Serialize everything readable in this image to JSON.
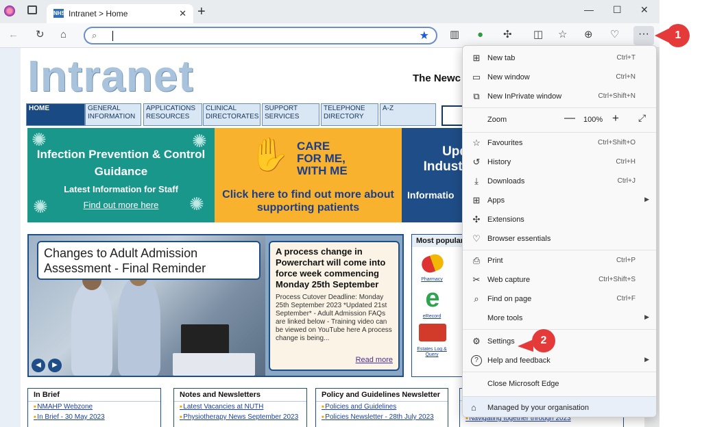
{
  "browser": {
    "tab_title": "Intranet > Home",
    "tab_icon_text": "NHS",
    "close_glyph": "✕",
    "new_tab_glyph": "+",
    "minimize_glyph": "—",
    "maximize_glyph": "☐",
    "close_window_glyph": "✕",
    "address_value": "",
    "more_glyph": "···"
  },
  "page": {
    "logo_text": "Intranet",
    "trust_name": "The Newc",
    "nav": [
      {
        "label": "HOME"
      },
      {
        "label": "GENERAL INFORMATION"
      },
      {
        "label": "APPLICATIONS RESOURCES"
      },
      {
        "label": "CLINICAL DIRECTORATES"
      },
      {
        "label": "SUPPORT SERVICES"
      },
      {
        "label": "TELEPHONE DIRECTORY"
      },
      {
        "label": "A-Z"
      }
    ],
    "banner1": {
      "heading": "Infection Prevention & Control Guidance",
      "sub": "Latest Information for Staff",
      "link": "Find out more here"
    },
    "banner2": {
      "title_line1": "CARE",
      "title_line2": "FOR ME,",
      "title_line3": "WITH ME",
      "cta": "Click here to find out more about supporting patients"
    },
    "banner3": {
      "title": "Upd Industr",
      "sub": "Informatio"
    },
    "news": {
      "headline": "Changes to Adult Admission Assessment - Final Reminder",
      "box_title": "A process change in Powerchart will come into force week commencing Monday 25th September",
      "box_text": "Process Cutover Deadline: Monday 25th September 2023 *Updated 21st September* - Adult Admission FAQs are linked below - Training video can be viewed on YouTube here A process change is being...",
      "read_more": "Read more",
      "prev_glyph": "◀",
      "next_glyph": "▶"
    },
    "popular": {
      "heading": "Most popular",
      "items": [
        {
          "label": "Pharmacy"
        },
        {
          "label": "eRecord"
        },
        {
          "label": "Estates Log & Query"
        }
      ]
    },
    "boxes": [
      {
        "heading": "In Brief",
        "items": [
          "NMAHP Webzone",
          "In Brief - 30 May 2023"
        ]
      },
      {
        "heading": "Notes and Newsletters",
        "items": [
          "Latest Vacancies at NUTH",
          "Physiotherapy News September 2023"
        ]
      },
      {
        "heading": "Policy and Guidelines Newsletter",
        "items": [
          "Policies and Guidelines",
          "Policies Newsletter - 28th July 2023"
        ]
      },
      {
        "heading": "",
        "items": [
          "",
          "Navigating together through 2023"
        ]
      }
    ]
  },
  "menu": {
    "items": [
      {
        "icon": "new-tab-icon",
        "glyph": "⊞",
        "label": "New tab",
        "shortcut": "Ctrl+T"
      },
      {
        "icon": "new-window-icon",
        "glyph": "▭",
        "label": "New window",
        "shortcut": "Ctrl+N"
      },
      {
        "icon": "inprivate-icon",
        "glyph": "⧉",
        "label": "New InPrivate window",
        "shortcut": "Ctrl+Shift+N"
      },
      {
        "icon": "favourites-icon",
        "glyph": "☆",
        "label": "Favourites",
        "shortcut": "Ctrl+Shift+O"
      },
      {
        "icon": "history-icon",
        "glyph": "↺",
        "label": "History",
        "shortcut": "Ctrl+H"
      },
      {
        "icon": "downloads-icon",
        "glyph": "⤓",
        "label": "Downloads",
        "shortcut": "Ctrl+J"
      },
      {
        "icon": "apps-icon",
        "glyph": "⊞",
        "label": "Apps",
        "shortcut": ""
      },
      {
        "icon": "extensions-icon",
        "glyph": "✣",
        "label": "Extensions",
        "shortcut": ""
      },
      {
        "icon": "browser-essentials-icon",
        "glyph": "♡",
        "label": "Browser essentials",
        "shortcut": ""
      },
      {
        "icon": "print-icon",
        "glyph": "⎙",
        "label": "Print",
        "shortcut": "Ctrl+P"
      },
      {
        "icon": "web-capture-icon",
        "glyph": "✂",
        "label": "Web capture",
        "shortcut": "Ctrl+Shift+S"
      },
      {
        "icon": "find-icon",
        "glyph": "⌕",
        "label": "Find on page",
        "shortcut": "Ctrl+F"
      },
      {
        "icon": "",
        "glyph": "",
        "label": "More tools",
        "shortcut": ""
      },
      {
        "icon": "settings-icon",
        "glyph": "⚙",
        "label": "Settings",
        "shortcut": ""
      },
      {
        "icon": "help-icon",
        "glyph": "?",
        "label": "Help and feedback",
        "shortcut": ""
      },
      {
        "icon": "",
        "glyph": "",
        "label": "Close Microsoft Edge",
        "shortcut": ""
      }
    ],
    "zoom": {
      "label": "Zoom",
      "value": "100%",
      "minus": "—",
      "plus": "+",
      "fullscreen": "⤢"
    },
    "managed": {
      "glyph": "⌂",
      "label": "Managed by your organisation"
    },
    "submenu_arrow": "▶"
  },
  "callouts": [
    "1",
    "2"
  ],
  "colors": {
    "callout": "#e53a3a",
    "accent": "#1a5fd1",
    "nhs_blue": "#1f4d87"
  }
}
